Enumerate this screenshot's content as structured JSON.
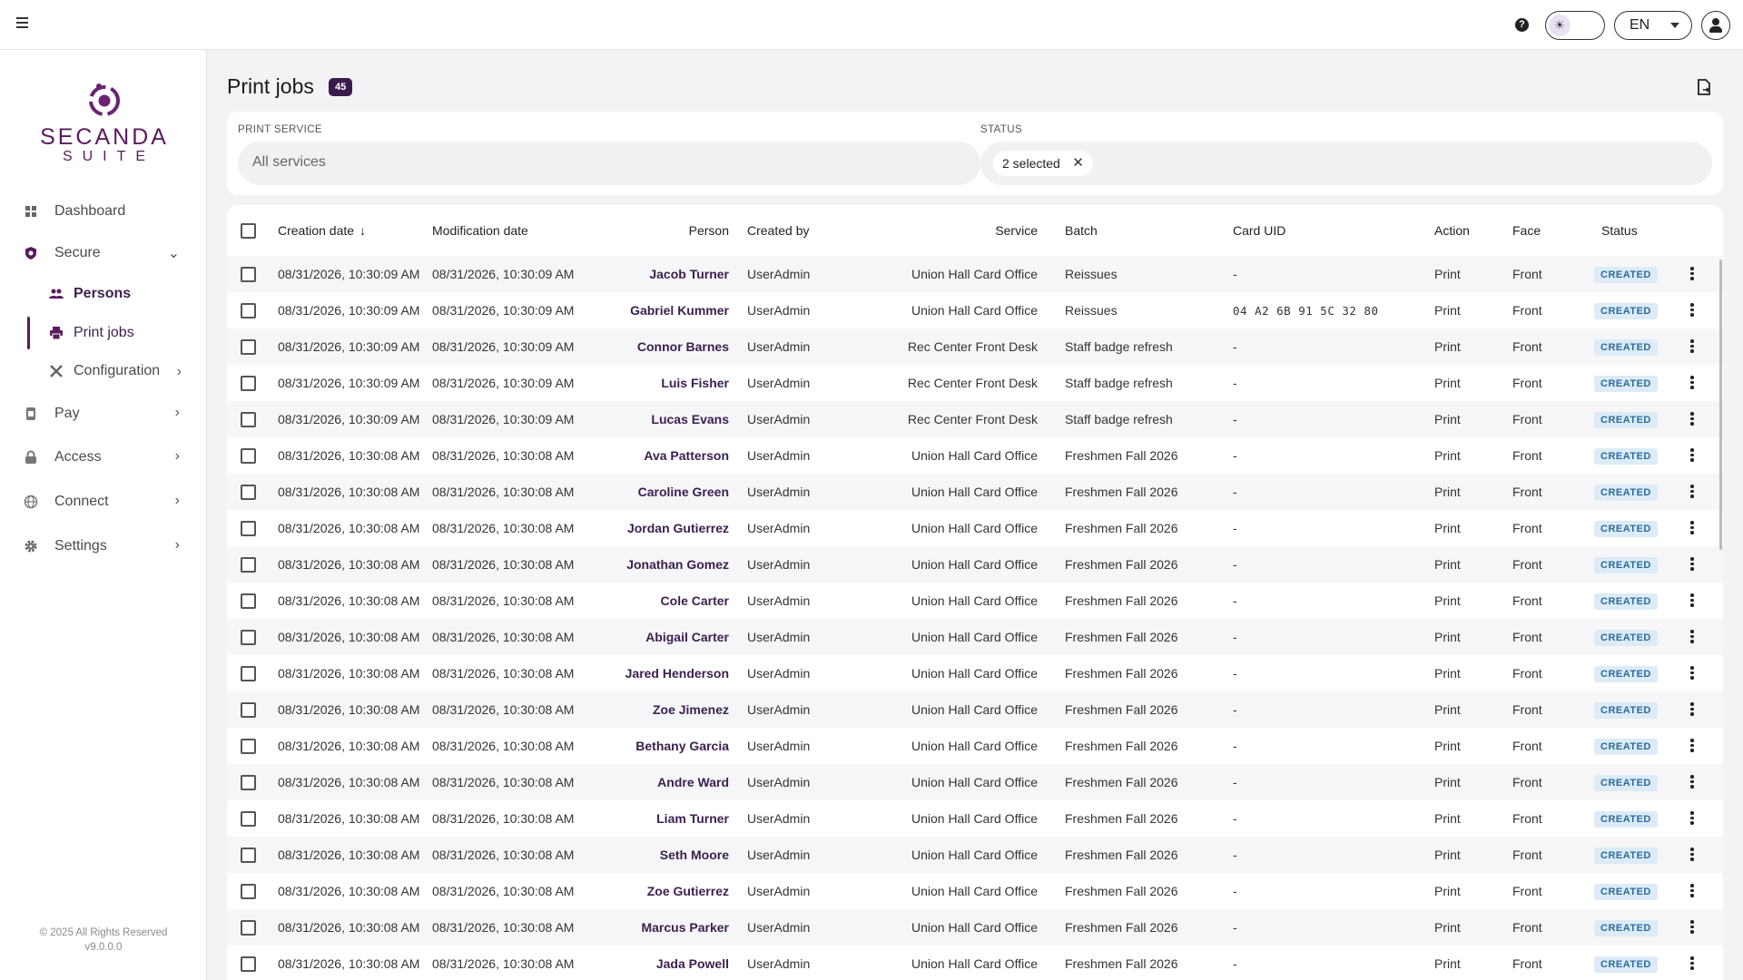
{
  "topbar": {
    "help_glyph": "?",
    "theme_glyph": "☀",
    "language": "EN"
  },
  "brand": {
    "name": "SECANDA",
    "subtitle": "SUITE"
  },
  "sidebar": {
    "items": [
      {
        "label": "Dashboard",
        "icon": "dashboard-icon"
      },
      {
        "label": "Secure",
        "icon": "shield-icon",
        "expanded": true,
        "children": [
          {
            "label": "Persons",
            "icon": "people-icon"
          },
          {
            "label": "Print jobs",
            "icon": "printer-icon",
            "active": true
          },
          {
            "label": "Configuration",
            "icon": "tools-icon"
          }
        ]
      },
      {
        "label": "Pay",
        "icon": "wallet-icon"
      },
      {
        "label": "Access",
        "icon": "lock-icon"
      },
      {
        "label": "Connect",
        "icon": "globe-icon"
      },
      {
        "label": "Settings",
        "icon": "gear-icon"
      }
    ],
    "footer_copyright": "© 2025 All Rights Reserved",
    "footer_version": "v9.0.0.0"
  },
  "page": {
    "title": "Print jobs",
    "count": "45"
  },
  "filters": {
    "print_service_label": "PRINT SERVICE",
    "print_service_placeholder": "All services",
    "status_label": "STATUS",
    "status_chip": "2 selected"
  },
  "table": {
    "headers": {
      "creation_date": "Creation date",
      "modification_date": "Modification date",
      "person": "Person",
      "created_by": "Created by",
      "service": "Service",
      "batch": "Batch",
      "card_uid": "Card UID",
      "action": "Action",
      "face": "Face",
      "status": "Status"
    },
    "rows": [
      {
        "created": "08/31/2026, 10:30:09 AM",
        "modified": "08/31/2026, 10:30:09 AM",
        "person": "Jacob Turner",
        "created_by": "UserAdmin",
        "service": "Union Hall Card Office",
        "batch": "Reissues",
        "card_uid": "-",
        "action": "Print",
        "face": "Front",
        "status": "CREATED"
      },
      {
        "created": "08/31/2026, 10:30:09 AM",
        "modified": "08/31/2026, 10:30:09 AM",
        "person": "Gabriel Kummer",
        "created_by": "UserAdmin",
        "service": "Union Hall Card Office",
        "batch": "Reissues",
        "card_uid": "04 A2 6B 91 5C 32 80",
        "action": "Print",
        "face": "Front",
        "status": "CREATED"
      },
      {
        "created": "08/31/2026, 10:30:09 AM",
        "modified": "08/31/2026, 10:30:09 AM",
        "person": "Connor Barnes",
        "created_by": "UserAdmin",
        "service": "Rec Center Front Desk",
        "batch": "Staff badge refresh",
        "card_uid": "-",
        "action": "Print",
        "face": "Front",
        "status": "CREATED"
      },
      {
        "created": "08/31/2026, 10:30:09 AM",
        "modified": "08/31/2026, 10:30:09 AM",
        "person": "Luis Fisher",
        "created_by": "UserAdmin",
        "service": "Rec Center Front Desk",
        "batch": "Staff badge refresh",
        "card_uid": "-",
        "action": "Print",
        "face": "Front",
        "status": "CREATED"
      },
      {
        "created": "08/31/2026, 10:30:09 AM",
        "modified": "08/31/2026, 10:30:09 AM",
        "person": "Lucas Evans",
        "created_by": "UserAdmin",
        "service": "Rec Center Front Desk",
        "batch": "Staff badge refresh",
        "card_uid": "-",
        "action": "Print",
        "face": "Front",
        "status": "CREATED"
      },
      {
        "created": "08/31/2026, 10:30:08 AM",
        "modified": "08/31/2026, 10:30:08 AM",
        "person": "Ava Patterson",
        "created_by": "UserAdmin",
        "service": "Union Hall Card Office",
        "batch": "Freshmen Fall 2026",
        "card_uid": "-",
        "action": "Print",
        "face": "Front",
        "status": "CREATED"
      },
      {
        "created": "08/31/2026, 10:30:08 AM",
        "modified": "08/31/2026, 10:30:08 AM",
        "person": "Caroline Green",
        "created_by": "UserAdmin",
        "service": "Union Hall Card Office",
        "batch": "Freshmen Fall 2026",
        "card_uid": "-",
        "action": "Print",
        "face": "Front",
        "status": "CREATED"
      },
      {
        "created": "08/31/2026, 10:30:08 AM",
        "modified": "08/31/2026, 10:30:08 AM",
        "person": "Jordan Gutierrez",
        "created_by": "UserAdmin",
        "service": "Union Hall Card Office",
        "batch": "Freshmen Fall 2026",
        "card_uid": "-",
        "action": "Print",
        "face": "Front",
        "status": "CREATED"
      },
      {
        "created": "08/31/2026, 10:30:08 AM",
        "modified": "08/31/2026, 10:30:08 AM",
        "person": "Jonathan Gomez",
        "created_by": "UserAdmin",
        "service": "Union Hall Card Office",
        "batch": "Freshmen Fall 2026",
        "card_uid": "-",
        "action": "Print",
        "face": "Front",
        "status": "CREATED"
      },
      {
        "created": "08/31/2026, 10:30:08 AM",
        "modified": "08/31/2026, 10:30:08 AM",
        "person": "Cole Carter",
        "created_by": "UserAdmin",
        "service": "Union Hall Card Office",
        "batch": "Freshmen Fall 2026",
        "card_uid": "-",
        "action": "Print",
        "face": "Front",
        "status": "CREATED"
      },
      {
        "created": "08/31/2026, 10:30:08 AM",
        "modified": "08/31/2026, 10:30:08 AM",
        "person": "Abigail Carter",
        "created_by": "UserAdmin",
        "service": "Union Hall Card Office",
        "batch": "Freshmen Fall 2026",
        "card_uid": "-",
        "action": "Print",
        "face": "Front",
        "status": "CREATED"
      },
      {
        "created": "08/31/2026, 10:30:08 AM",
        "modified": "08/31/2026, 10:30:08 AM",
        "person": "Jared Henderson",
        "created_by": "UserAdmin",
        "service": "Union Hall Card Office",
        "batch": "Freshmen Fall 2026",
        "card_uid": "-",
        "action": "Print",
        "face": "Front",
        "status": "CREATED"
      },
      {
        "created": "08/31/2026, 10:30:08 AM",
        "modified": "08/31/2026, 10:30:08 AM",
        "person": "Zoe Jimenez",
        "created_by": "UserAdmin",
        "service": "Union Hall Card Office",
        "batch": "Freshmen Fall 2026",
        "card_uid": "-",
        "action": "Print",
        "face": "Front",
        "status": "CREATED"
      },
      {
        "created": "08/31/2026, 10:30:08 AM",
        "modified": "08/31/2026, 10:30:08 AM",
        "person": "Bethany Garcia",
        "created_by": "UserAdmin",
        "service": "Union Hall Card Office",
        "batch": "Freshmen Fall 2026",
        "card_uid": "-",
        "action": "Print",
        "face": "Front",
        "status": "CREATED"
      },
      {
        "created": "08/31/2026, 10:30:08 AM",
        "modified": "08/31/2026, 10:30:08 AM",
        "person": "Andre Ward",
        "created_by": "UserAdmin",
        "service": "Union Hall Card Office",
        "batch": "Freshmen Fall 2026",
        "card_uid": "-",
        "action": "Print",
        "face": "Front",
        "status": "CREATED"
      },
      {
        "created": "08/31/2026, 10:30:08 AM",
        "modified": "08/31/2026, 10:30:08 AM",
        "person": "Liam Turner",
        "created_by": "UserAdmin",
        "service": "Union Hall Card Office",
        "batch": "Freshmen Fall 2026",
        "card_uid": "-",
        "action": "Print",
        "face": "Front",
        "status": "CREATED"
      },
      {
        "created": "08/31/2026, 10:30:08 AM",
        "modified": "08/31/2026, 10:30:08 AM",
        "person": "Seth Moore",
        "created_by": "UserAdmin",
        "service": "Union Hall Card Office",
        "batch": "Freshmen Fall 2026",
        "card_uid": "-",
        "action": "Print",
        "face": "Front",
        "status": "CREATED"
      },
      {
        "created": "08/31/2026, 10:30:08 AM",
        "modified": "08/31/2026, 10:30:08 AM",
        "person": "Zoe Gutierrez",
        "created_by": "UserAdmin",
        "service": "Union Hall Card Office",
        "batch": "Freshmen Fall 2026",
        "card_uid": "-",
        "action": "Print",
        "face": "Front",
        "status": "CREATED"
      },
      {
        "created": "08/31/2026, 10:30:08 AM",
        "modified": "08/31/2026, 10:30:08 AM",
        "person": "Marcus Parker",
        "created_by": "UserAdmin",
        "service": "Union Hall Card Office",
        "batch": "Freshmen Fall 2026",
        "card_uid": "-",
        "action": "Print",
        "face": "Front",
        "status": "CREATED"
      },
      {
        "created": "08/31/2026, 10:30:08 AM",
        "modified": "08/31/2026, 10:30:08 AM",
        "person": "Jada Powell",
        "created_by": "UserAdmin",
        "service": "Union Hall Card Office",
        "batch": "Freshmen Fall 2026",
        "card_uid": "-",
        "action": "Print",
        "face": "Front",
        "status": "CREATED"
      }
    ]
  },
  "colors": {
    "brand": "#5a1a5e",
    "badge": "#3a1a4a",
    "status_bg": "#dcebf6",
    "status_text": "#2a6b9e"
  }
}
